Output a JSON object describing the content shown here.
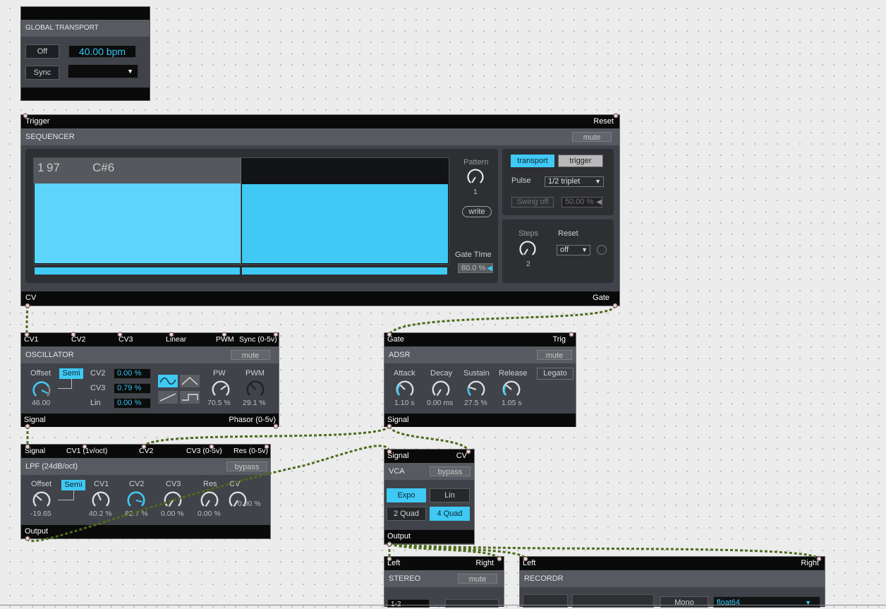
{
  "transport": {
    "title": "GLOBAL TRANSPORT",
    "off": "Off",
    "bpm": "40.00 bpm",
    "sync": "Sync",
    "dropdown": ""
  },
  "sequencer": {
    "in_trigger": "Trigger",
    "in_reset": "Reset",
    "title": "SEQUENCER",
    "mute": "mute",
    "step_num": "1",
    "step_val": "97",
    "step_note": "C#6",
    "pattern_label": "Pattern",
    "pattern_value": "1",
    "write": "write",
    "gate_time_label": "Gate TIme",
    "gate_time_value": "80.0 %",
    "transport": "transport",
    "trigger": "trigger",
    "pulse_label": "Pulse",
    "pulse_value": "1/2 triplet",
    "swing": "Swing off",
    "swing_value": "50.00 %",
    "steps_label": "Steps",
    "steps_value": "2",
    "reset_label": "Reset",
    "reset_value": "off",
    "out_cv": "CV",
    "out_gate": "Gate"
  },
  "oscillator": {
    "in": [
      "CV1",
      "CV2",
      "CV3",
      "Linear",
      "PWM",
      "Sync (0-5v)"
    ],
    "title": "OSCILLATOR",
    "mute": "mute",
    "offset_label": "Offset",
    "semi": "Semi",
    "offset_value": "46.00",
    "cv2_label": "CV2",
    "cv2_value": "0.00 %",
    "cv3_label": "CV3",
    "cv3_value": "0.79 %",
    "lin_label": "Lin",
    "lin_value": "0.00 %",
    "pw_label": "PW",
    "pw_value": "70.5 %",
    "pwm_label": "PWM",
    "pwm_value": "29.1 %",
    "out_signal": "Signal",
    "out_phasor": "Phasor (0-5v)"
  },
  "adsr": {
    "in_gate": "Gate",
    "in_trig": "Trig",
    "title": "ADSR",
    "mute": "mute",
    "attack_label": "Attack",
    "attack_value": "1.10 s",
    "decay_label": "Decay",
    "decay_value": "0.00 ms",
    "sustain_label": "Sustain",
    "sustain_value": "27.5 %",
    "release_label": "Release",
    "release_value": "1.05 s",
    "legato": "Legato",
    "out_signal": "Signal"
  },
  "lpf": {
    "in": [
      "Signal",
      "CV1 (1v/oct)",
      "CV2",
      "CV3 (0-5v)",
      "Res (0-5v)"
    ],
    "title": "LPF (24dB/oct)",
    "bypass": "bypass",
    "offset_label": "Offset",
    "semi": "Semi",
    "offset_value": "-19.65",
    "cv1_label": "CV1",
    "cv1_value": "40.2 %",
    "cv2_label": "CV2",
    "cv2_value": "82.7 %",
    "cv3_label": "CV3",
    "cv3_value": "0.00 %",
    "res_label": "Res",
    "res_value": "0.00 %",
    "cv_label": "CV",
    "cv_value": "0.00 %",
    "out": "Output"
  },
  "vca": {
    "in_signal": "Signal",
    "in_cv": "CV",
    "title": "VCA",
    "bypass": "bypass",
    "expo": "Expo",
    "lin": "Lin",
    "quad2": "2 Quad",
    "quad4": "4 Quad",
    "out": "Output"
  },
  "stereo": {
    "in_left": "Left",
    "in_right": "Right",
    "title": "STEREO",
    "mute": "mute",
    "channel": "1-2"
  },
  "recordr": {
    "in_left": "Left",
    "in_right": "Right",
    "title": "RECORDR",
    "mono": "Mono",
    "format": "float64"
  },
  "colors": {
    "accent": "#3fc9f4",
    "panel": "#404349",
    "header": "#575a60",
    "cable": "#4e6b1c"
  }
}
